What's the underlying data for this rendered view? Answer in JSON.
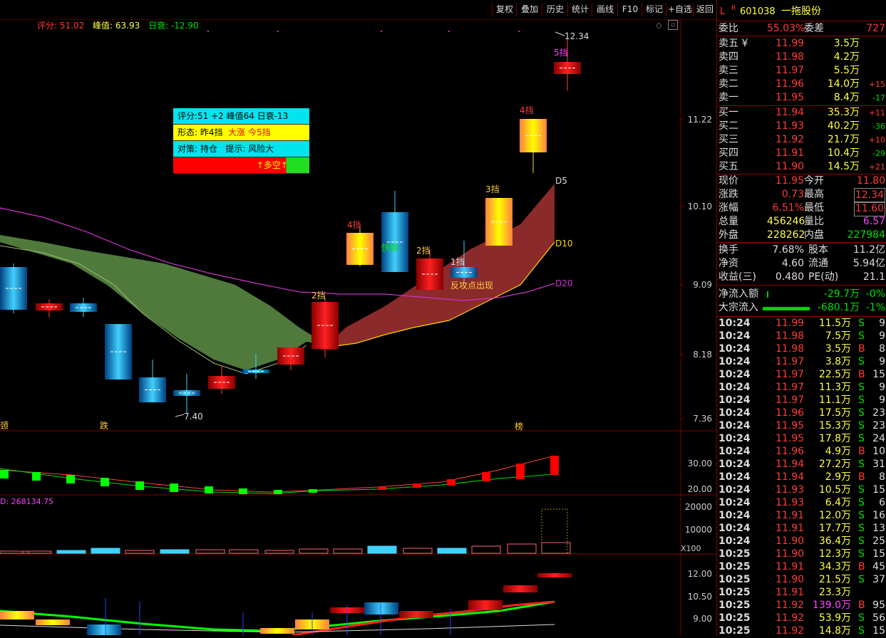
{
  "toolbar": {
    "items": [
      "复权",
      "叠加",
      "历史",
      "统计",
      "画线",
      "F10",
      "标记",
      "+自选",
      "返回"
    ]
  },
  "indicator_bar": {
    "score_label": "评分: 51.02",
    "peak_label": "峰值: 63.93",
    "decay_label": "日衰: -12.90"
  },
  "info_box": {
    "line1": "评分:51  +2     峰值64   日衰-13",
    "line2_a": "形态: 昨4挡",
    "line2_b": "大涨 今5挡",
    "line3_a": "对策: 持仓",
    "line3_b": "提示: 风险大",
    "line4": "↑多空↑"
  },
  "main_chart": {
    "price_ticks": [
      "11.22",
      "10.10",
      "9.09",
      "8.18",
      "7.36"
    ],
    "high_marker": "12.34",
    "low_marker": "7.40",
    "line_labels": [
      "D5",
      "D10",
      "D20"
    ],
    "annotations": [
      "5挡",
      "4挡",
      "3挡",
      "4挡",
      "2挡",
      "2挡",
      "1挡",
      "快跑",
      "反攻点出现"
    ],
    "bottom_labels": [
      "颈",
      "跌",
      "榜"
    ]
  },
  "sub1": {
    "ticks": [
      "30.00",
      "20.00"
    ]
  },
  "sub2": {
    "value_label": "D: 268134.75",
    "ticks": [
      "20000",
      "10000"
    ],
    "unit": "X100"
  },
  "sub3": {
    "ticks": [
      "12.00",
      "10.50",
      "9.00"
    ]
  },
  "colors": {
    "up": "#ff2020",
    "down": "#00b0ff",
    "green_band": "#4f7a3c",
    "red_band": "#8b2a2a",
    "ma20": "#cc33cc",
    "axis": "#800000"
  },
  "side": {
    "header": {
      "market": "L",
      "tag": "R",
      "code": "601038",
      "name": "一拖股份"
    },
    "weibi": {
      "label": "委比",
      "value": "55.03%",
      "label2": "委差",
      "value2": "727"
    },
    "asks": [
      {
        "label": "卖五",
        "mark": "¥",
        "price": "11.99",
        "vol": "3.5万",
        "chg": ""
      },
      {
        "label": "卖四",
        "mark": "",
        "price": "11.98",
        "vol": "4.2万",
        "chg": ""
      },
      {
        "label": "卖三",
        "mark": "",
        "price": "11.97",
        "vol": "5.5万",
        "chg": ""
      },
      {
        "label": "卖二",
        "mark": "",
        "price": "11.96",
        "vol": "14.0万",
        "chg": "+15"
      },
      {
        "label": "卖一",
        "mark": "",
        "price": "11.95",
        "vol": "8.4万",
        "chg": "-17"
      }
    ],
    "bids": [
      {
        "label": "买一",
        "price": "11.94",
        "vol": "35.3万",
        "chg": "+11"
      },
      {
        "label": "买二",
        "price": "11.93",
        "vol": "40.2万",
        "chg": "-36"
      },
      {
        "label": "买三",
        "price": "11.92",
        "vol": "21.7万",
        "chg": "+10"
      },
      {
        "label": "买四",
        "price": "11.91",
        "vol": "10.4万",
        "chg": "-29"
      },
      {
        "label": "买五",
        "price": "11.90",
        "vol": "14.5万",
        "chg": "+21"
      }
    ],
    "quote": [
      {
        "l1": "现价",
        "v1": "11.95",
        "l2": "今开",
        "v2": "11.80"
      },
      {
        "l1": "涨跌",
        "v1": "0.73",
        "l2": "最高",
        "v2": "12.34"
      },
      {
        "l1": "涨幅",
        "v1": "6.51%",
        "l2": "最低",
        "v2": "11.60"
      },
      {
        "l1": "总量",
        "v1": "456246",
        "l2": "量比",
        "v2": "6.57"
      },
      {
        "l1": "外盘",
        "v1": "228262",
        "l2": "内盘",
        "v2": "227984"
      }
    ],
    "fund": [
      {
        "l1": "换手",
        "v1": "7.68%",
        "l2": "股本",
        "v2": "11.2亿"
      },
      {
        "l1": "净资",
        "v1": "4.60",
        "l2": "流通",
        "v2": "5.94亿"
      },
      {
        "l1": "收益(三)",
        "v1": "0.480",
        "l2": "PE(动)",
        "v2": "21.1"
      }
    ],
    "flow": [
      {
        "label": "净流入额",
        "value": "-29.7万",
        "pct": "-0%"
      },
      {
        "label": "大宗流入",
        "value": "-680.1万",
        "pct": "-1%"
      }
    ],
    "ticks": [
      {
        "t": "10:24",
        "p": "11.99",
        "v": "11.5万",
        "s": "S",
        "n": "9"
      },
      {
        "t": "10:24",
        "p": "11.98",
        "v": "7.5万",
        "s": "S",
        "n": "9"
      },
      {
        "t": "10:24",
        "p": "11.98",
        "v": "3.5万",
        "s": "B",
        "n": "8"
      },
      {
        "t": "10:24",
        "p": "11.97",
        "v": "3.8万",
        "s": "S",
        "n": "9"
      },
      {
        "t": "10:24",
        "p": "11.97",
        "v": "22.5万",
        "s": "B",
        "n": "15"
      },
      {
        "t": "10:24",
        "p": "11.97",
        "v": "11.3万",
        "s": "S",
        "n": "9"
      },
      {
        "t": "10:24",
        "p": "11.97",
        "v": "11.1万",
        "s": "S",
        "n": "9"
      },
      {
        "t": "10:24",
        "p": "11.96",
        "v": "17.5万",
        "s": "S",
        "n": "23"
      },
      {
        "t": "10:24",
        "p": "11.95",
        "v": "15.3万",
        "s": "S",
        "n": "23"
      },
      {
        "t": "10:24",
        "p": "11.95",
        "v": "17.8万",
        "s": "S",
        "n": "24"
      },
      {
        "t": "10:24",
        "p": "11.96",
        "v": "4.9万",
        "s": "B",
        "n": "10"
      },
      {
        "t": "10:24",
        "p": "11.94",
        "v": "27.2万",
        "s": "S",
        "n": "31"
      },
      {
        "t": "10:24",
        "p": "11.94",
        "v": "2.9万",
        "s": "B",
        "n": "8"
      },
      {
        "t": "10:24",
        "p": "11.93",
        "v": "10.5万",
        "s": "S",
        "n": "15"
      },
      {
        "t": "10:24",
        "p": "11.93",
        "v": "6.4万",
        "s": "S",
        "n": "6"
      },
      {
        "t": "10:24",
        "p": "11.91",
        "v": "12.0万",
        "s": "S",
        "n": "16"
      },
      {
        "t": "10:24",
        "p": "11.91",
        "v": "17.7万",
        "s": "S",
        "n": "13"
      },
      {
        "t": "10:24",
        "p": "11.90",
        "v": "36.4万",
        "s": "S",
        "n": "25"
      },
      {
        "t": "10:25",
        "p": "11.90",
        "v": "12.3万",
        "s": "S",
        "n": "15"
      },
      {
        "t": "10:25",
        "p": "11.91",
        "v": "34.3万",
        "s": "B",
        "n": "45"
      },
      {
        "t": "10:25",
        "p": "11.90",
        "v": "21.5万",
        "s": "S",
        "n": "37"
      },
      {
        "t": "10:25",
        "p": "11.91",
        "v": "23.3万",
        "s": "",
        "n": ""
      },
      {
        "t": "10:25",
        "p": "11.92",
        "v": "139.0万",
        "s": "B",
        "n": "95"
      },
      {
        "t": "10:25",
        "p": "11.92",
        "v": "53.9万",
        "s": "S",
        "n": "56"
      },
      {
        "t": "10:25",
        "p": "11.92",
        "v": "14.8万",
        "s": "S",
        "n": "15"
      }
    ]
  }
}
